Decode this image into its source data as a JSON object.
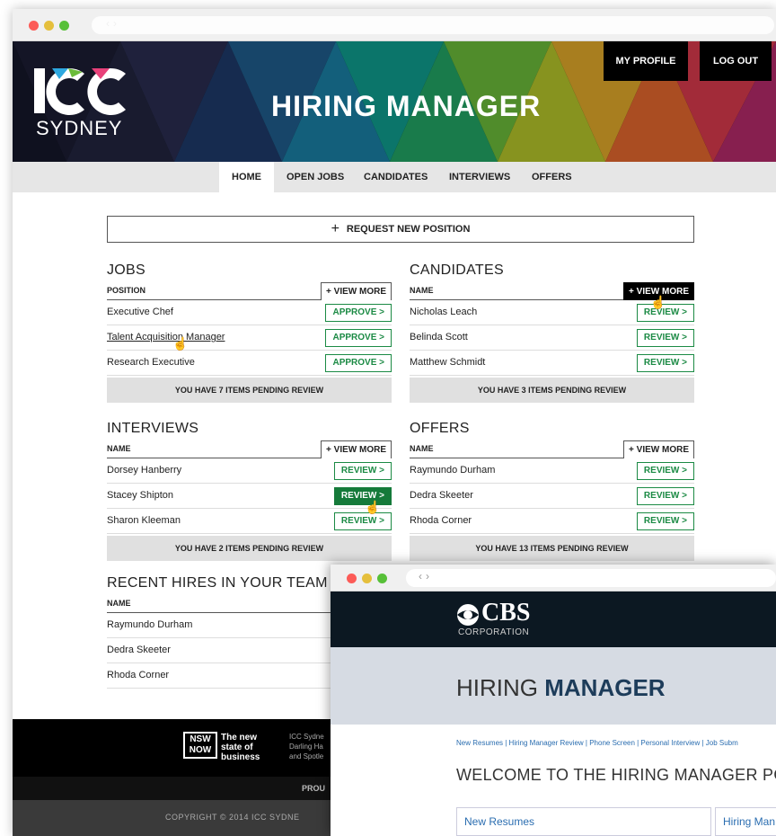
{
  "app": {
    "logo_text": "SYDNEY",
    "title": "HIRING MANAGER",
    "header_buttons": [
      "MY PROFILE",
      "LOG OUT"
    ]
  },
  "nav": [
    "HOME",
    "OPEN JOBS",
    "CANDIDATES",
    "INTERVIEWS",
    "OFFERS"
  ],
  "request_button": "REQUEST NEW POSITION",
  "view_more": "+ VIEW MORE",
  "jobs": {
    "title": "JOBS",
    "column": "POSITION",
    "rows": [
      {
        "name": "Executive Chef",
        "action": "APPROVE >"
      },
      {
        "name": "Talent Acquisition Manager",
        "action": "APPROVE >"
      },
      {
        "name": "Research Executive",
        "action": "APPROVE >"
      }
    ],
    "pending": "YOU HAVE 7 ITEMS PENDING REVIEW"
  },
  "candidates": {
    "title": "CANDIDATES",
    "column": "NAME",
    "rows": [
      {
        "name": "Nicholas Leach",
        "action": "REVIEW >"
      },
      {
        "name": "Belinda Scott",
        "action": "REVIEW >"
      },
      {
        "name": "Matthew Schmidt",
        "action": "REVIEW >"
      }
    ],
    "pending": "YOU HAVE 3 ITEMS PENDING REVIEW"
  },
  "interviews": {
    "title": "INTERVIEWS",
    "column": "NAME",
    "rows": [
      {
        "name": "Dorsey Hanberry",
        "action": "REVIEW >"
      },
      {
        "name": "Stacey Shipton",
        "action": "REVIEW >"
      },
      {
        "name": "Sharon Kleeman",
        "action": "REVIEW >"
      }
    ],
    "pending": "YOU HAVE 2 ITEMS PENDING REVIEW"
  },
  "offers": {
    "title": "OFFERS",
    "column": "NAME",
    "rows": [
      {
        "name": "Raymundo Durham",
        "action": "REVIEW >"
      },
      {
        "name": "Dedra Skeeter",
        "action": "REVIEW >"
      },
      {
        "name": "Rhoda Corner",
        "action": "REVIEW >"
      }
    ],
    "pending": "YOU HAVE 13 ITEMS PENDING REVIEW"
  },
  "recent_hires": {
    "title": "RECENT HIRES IN YOUR TEAM",
    "column": "NAME",
    "rows": [
      "Raymundo Durham",
      "Dedra Skeeter",
      "Rhoda Corner"
    ]
  },
  "footer": {
    "nsw_badge": "NSW NOW",
    "tagline": [
      "The new",
      "state of",
      "business"
    ],
    "address": [
      "ICC Sydne",
      "Darling Ha",
      "and Spotle"
    ],
    "proud": "PROU",
    "copyright": "COPYRIGHT © 2014 ICC SYDNE"
  },
  "window2": {
    "logo_word": "CBS",
    "logo_sub": "CORPORATION",
    "title_light": "HIRING ",
    "title_bold": "MANAGER",
    "links": "New Resumes | Hiring Manager Review | Phone Screen | Personal Interview | Job Subm",
    "welcome": "WELCOME TO THE HIRING MANAGER POR",
    "tabs": [
      "New Resumes",
      "Hiring Man"
    ]
  },
  "colors": {
    "accent_green": "#1b8a44",
    "header_dark": "#000000",
    "cbs_navy": "#0c1822"
  }
}
